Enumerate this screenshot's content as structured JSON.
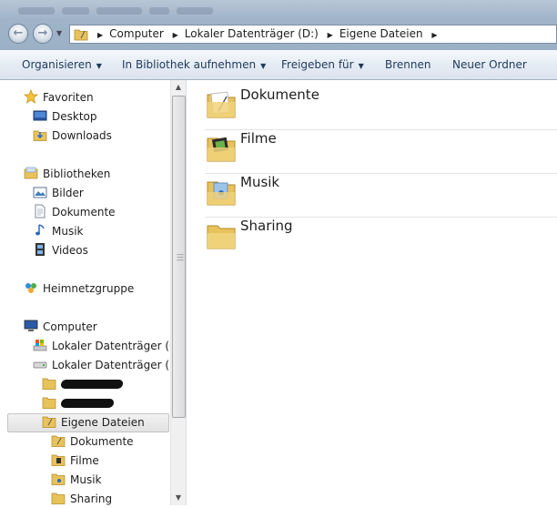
{
  "address": {
    "crumbs": [
      "Computer",
      "Lokaler Datenträger (D:)",
      "Eigene Dateien"
    ]
  },
  "commandbar": {
    "organize": "Organisieren",
    "include_library": "In Bibliothek aufnehmen",
    "share": "Freigeben für",
    "burn": "Brennen",
    "new_folder": "Neuer Ordner"
  },
  "nav": {
    "favorites": "Favoriten",
    "desktop": "Desktop",
    "downloads": "Downloads",
    "libraries": "Bibliotheken",
    "pictures": "Bilder",
    "documents": "Dokumente",
    "music": "Musik",
    "videos": "Videos",
    "homegroup": "Heimnetzgruppe",
    "computer": "Computer",
    "drive_c": "Lokaler Datenträger (C:)",
    "drive_d": "Lokaler Datenträger (D:)",
    "own_files": "Eigene Dateien",
    "sub_documents": "Dokumente",
    "sub_movies": "Filme",
    "sub_music": "Musik",
    "sub_sharing": "Sharing"
  },
  "content": {
    "folders": [
      "Dokumente",
      "Filme",
      "Musik",
      "Sharing"
    ]
  },
  "colors": {
    "folder_yellow": "#e8c25a",
    "title_gradient": "#9fb3c9",
    "command_text": "#1e395b"
  }
}
